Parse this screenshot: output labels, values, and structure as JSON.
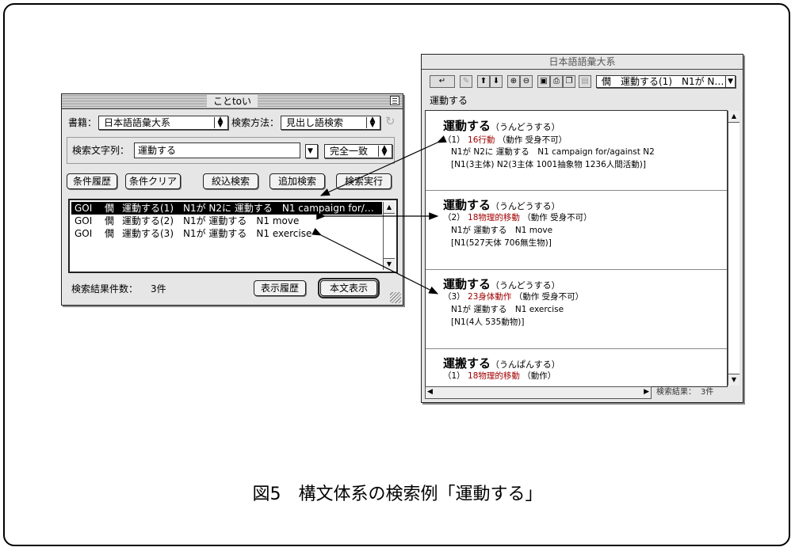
{
  "kototoi": {
    "title": "ことtoい",
    "shoseki_label": "書籍：",
    "shoseki_value": "日本語語彙大系",
    "method_label": "検索方法：",
    "method_value": "見出し語検索",
    "query_label": "検索文字列：",
    "query_value": "運動する",
    "match_value": "完全一致",
    "buttons": [
      "条件履歴",
      "条件クリア",
      "絞込検索",
      "追加検索",
      "検索実行"
    ],
    "results": [
      {
        "goi": "GOI",
        "mark": "僩",
        "text": "運動する(1)　N1が N2に 運動する　N1 campaign for/…"
      },
      {
        "goi": "GOI",
        "mark": "僩",
        "text": "運動する(2)　N1が 運動する　N1 move"
      },
      {
        "goi": "GOI",
        "mark": "僩",
        "text": "運動する(3)　N1が 運動する　N1 exercise"
      }
    ],
    "count_label": "検索結果件数：",
    "count_value": "3件",
    "history_button": "表示履歴",
    "show_button": "本文表示"
  },
  "goitaikei": {
    "title": "日本語語彙大系",
    "toolbar_select": "僩　運動する(1)　N1が N…",
    "headword": "運動する",
    "entries": [
      {
        "head": "運動する",
        "reading": "（うんどうする）",
        "num": "（1）",
        "cat": "16行動",
        "attr": "（動作 受身不可）",
        "l1": "N1が N2に 運動する　N1 campaign for/against N2",
        "l2": "[N1(3主体) N2(3主体 1001抽象物 1236人間活動)]"
      },
      {
        "head": "運動する",
        "reading": "（うんどうする）",
        "num": "（2）",
        "cat": "18物理的移動",
        "attr": "（動作 受身不可）",
        "l1": "N1が 運動する　N1 move",
        "l2": "[N1(527天体 706無生物)]"
      },
      {
        "head": "運動する",
        "reading": "（うんどうする）",
        "num": "（3）",
        "cat": "23身体動作",
        "attr": "（動作 受身不可）",
        "l1": "N1が 運動する　N1 exercise",
        "l2": "[N1(4人 535動物)]"
      },
      {
        "head": "運搬する",
        "reading": "（うんぱんする）",
        "num": "（1）",
        "cat": "18物理的移動",
        "attr": "（動作）",
        "l1": "",
        "l2": ""
      }
    ],
    "status_label": "検索結果：",
    "status_value": "3件"
  },
  "caption": "図5　構文体系の検索例「運動する」"
}
